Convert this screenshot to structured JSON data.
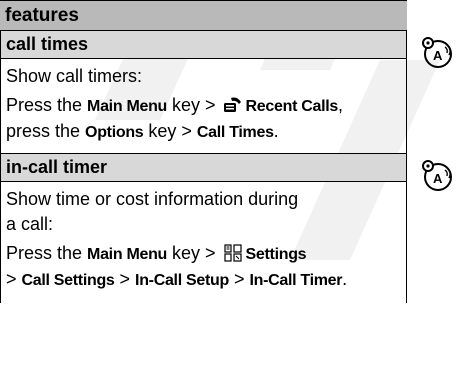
{
  "header": {
    "title": "features"
  },
  "sections": [
    {
      "title": "call times",
      "description": "Show call timers:",
      "instruction": {
        "p1": "Press the ",
        "main_menu": "Main Menu",
        "p2": " key > ",
        "menu_item": "Recent Calls",
        "p3": ",",
        "p4": "press the ",
        "options": "Options",
        "p5": " key > ",
        "final": "Call Times",
        "p6": "."
      },
      "icon": "network-feature-icon"
    },
    {
      "title": "in-call timer",
      "description_line1": "Show time or cost information during",
      "description_line2": "a call:",
      "instruction": {
        "p1": "Press the ",
        "main_menu": "Main Menu",
        "p2": " key > ",
        "menu_item": "Settings",
        "p3": "> ",
        "call_settings": "Call Settings",
        "p4": " > ",
        "in_call_setup": "In-Call Setup",
        "p5": " > ",
        "in_call_timer": "In-Call Timer",
        "p6": "."
      },
      "icon": "network-feature-icon"
    }
  ]
}
